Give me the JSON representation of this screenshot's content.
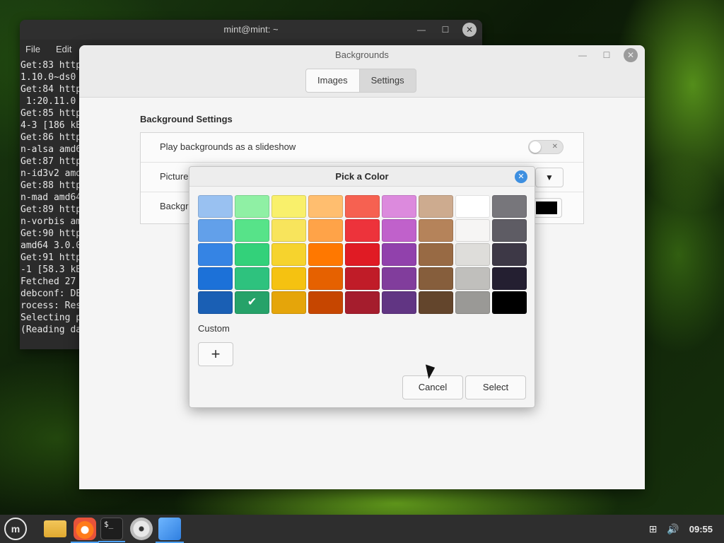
{
  "terminal": {
    "title": "mint@mint: ~",
    "menu": [
      "File",
      "Edit"
    ],
    "lines": [
      "Get:83 http",
      "1.10.0~ds0",
      "Get:84 http",
      " 1:20.11.0",
      "Get:85 http",
      "4-3 [186 kB",
      "Get:86 http",
      "n-alsa amd6",
      "Get:87 http",
      "n-id3v2 amd",
      "Get:88 http",
      "n-mad amd64",
      "Get:89 http",
      "n-vorbis am",
      "Get:90 http",
      "amd64 3.0.0",
      "Get:91 http",
      "-1 [58.3 kB",
      "Fetched 27",
      "debconf: DE",
      "rocess: Res",
      "Selecting p",
      "(Reading da"
    ]
  },
  "backgrounds": {
    "title": "Backgrounds",
    "tabs": {
      "images": "Images",
      "settings": "Settings"
    },
    "section_heading": "Background Settings",
    "rows": {
      "slideshow": "Play backgrounds as a slideshow",
      "picture": "Picture",
      "background": "Backgr"
    },
    "slideshow_enabled": false,
    "background_color": "#000000"
  },
  "picker": {
    "title": "Pick a Color",
    "palette": [
      [
        "#99c1f1",
        "#8ff0a4",
        "#f9f06b",
        "#ffbe6f",
        "#f66151",
        "#dc8add",
        "#cdab8f",
        "#ffffff",
        "#77767b"
      ],
      [
        "#62a0ea",
        "#57e389",
        "#f8e45c",
        "#ffa348",
        "#ed333b",
        "#c061cb",
        "#b5835a",
        "#f6f5f4",
        "#5e5c64"
      ],
      [
        "#3584e4",
        "#33d17a",
        "#f6d32d",
        "#ff7800",
        "#e01b24",
        "#9141ac",
        "#986a44",
        "#deddda",
        "#3d3846"
      ],
      [
        "#1c71d8",
        "#2ec27e",
        "#f5c211",
        "#e66100",
        "#c01c28",
        "#813d9c",
        "#865e3c",
        "#c0bfbc",
        "#241f31"
      ],
      [
        "#1a5fb4",
        "#26a269",
        "#e5a50a",
        "#c64600",
        "#a51d2d",
        "#613583",
        "#63452c",
        "#9a9996",
        "#000000"
      ]
    ],
    "selected_color": "#26a269",
    "custom_label": "Custom",
    "add_custom_symbol": "+",
    "cancel_label": "Cancel",
    "select_label": "Select"
  },
  "taskbar": {
    "launchers": [
      "menu-icon",
      "folder-icon",
      "firefox-icon",
      "terminal-icon",
      "disc-icon",
      "backgrounds-icon"
    ],
    "clock": "09:55"
  },
  "colors": {
    "accent": "#3d8fe0",
    "taskbar_bg": "#2e2e2e"
  }
}
